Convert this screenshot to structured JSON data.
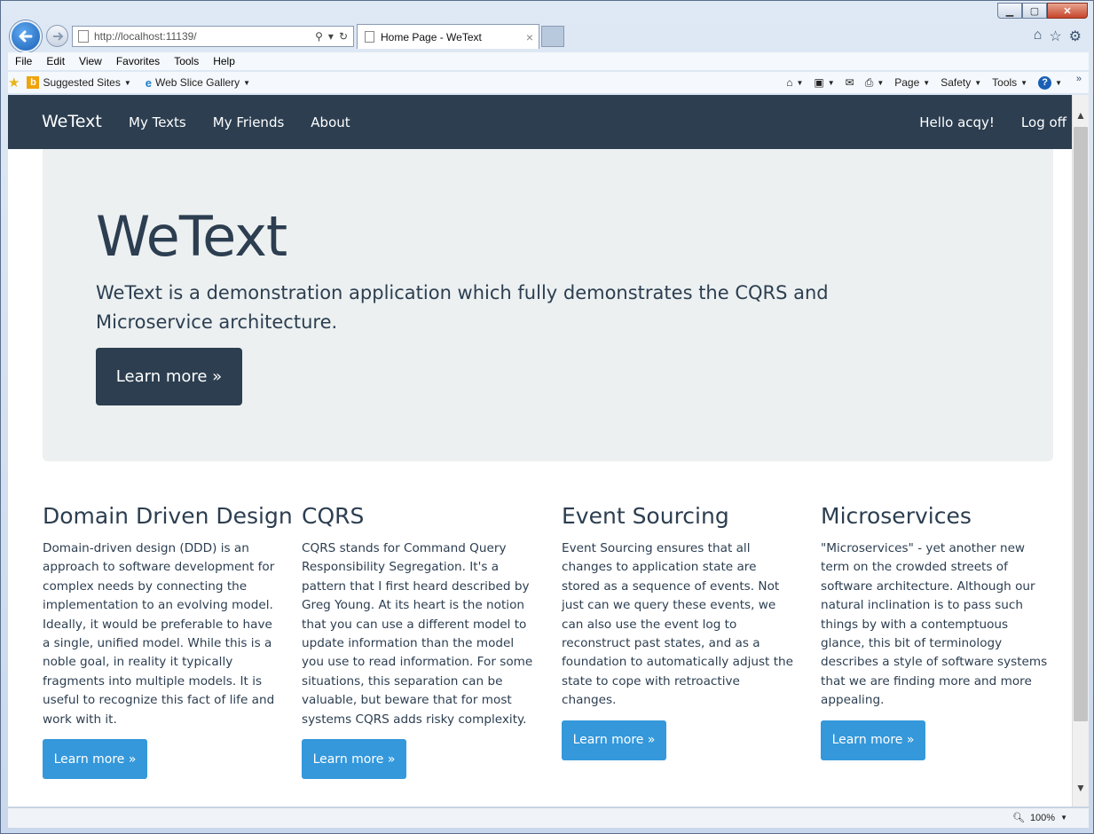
{
  "browser": {
    "url": "http://localhost:11139/",
    "tab_title": "Home Page - WeText",
    "menu": [
      "File",
      "Edit",
      "View",
      "Favorites",
      "Tools",
      "Help"
    ],
    "favorites": {
      "suggested": "Suggested Sites",
      "web_slice": "Web Slice Gallery"
    },
    "commands": {
      "page": "Page",
      "safety": "Safety",
      "tools": "Tools"
    },
    "zoom": "100%"
  },
  "site": {
    "brand": "WeText",
    "nav": [
      "My Texts",
      "My Friends",
      "About"
    ],
    "greeting": "Hello acqy!",
    "logoff": "Log off"
  },
  "jumbotron": {
    "title": "WeText",
    "lead": "WeText is a demonstration application which fully demonstrates the CQRS and Microservice architecture.",
    "button": "Learn more »"
  },
  "columns": [
    {
      "title": "Domain Driven Design",
      "body": "Domain-driven design (DDD) is an approach to software development for complex needs by connecting the implementation to an evolving model. Ideally, it would be preferable to have a single, unified model. While this is a noble goal, in reality it typically fragments into multiple models. It is useful to recognize this fact of life and work with it.",
      "button": "Learn more »"
    },
    {
      "title": "CQRS",
      "body": "CQRS stands for Command Query Responsibility Segregation. It's a pattern that I first heard described by Greg Young. At its heart is the notion that you can use a different model to update information than the model you use to read information. For some situations, this separation can be valuable, but beware that for most systems CQRS adds risky complexity.",
      "button": "Learn more »"
    },
    {
      "title": "Event Sourcing",
      "body": "Event Sourcing ensures that all changes to application state are stored as a sequence of events. Not just can we query these events, we can also use the event log to reconstruct past states, and as a foundation to automatically adjust the state to cope with retroactive changes.",
      "button": "Learn more »"
    },
    {
      "title": "Microservices",
      "body": "\"Microservices\" - yet another new term on the crowded streets of software architecture. Although our natural inclination is to pass such things by with a contemptuous glance, this bit of terminology describes a style of software systems that we are finding more and more appealing.",
      "button": "Learn more »"
    }
  ],
  "colors": {
    "navbar": "#2c3e50",
    "jumbotron_bg": "#ecf0f1",
    "primary_button": "#3498db"
  },
  "icons": [
    "back-icon",
    "forward-icon",
    "search-icon",
    "refresh-icon",
    "home-icon",
    "favorites-star-icon",
    "settings-gear-icon",
    "rss-feed-icon",
    "mail-icon",
    "print-icon",
    "help-icon",
    "zoom-icon"
  ]
}
